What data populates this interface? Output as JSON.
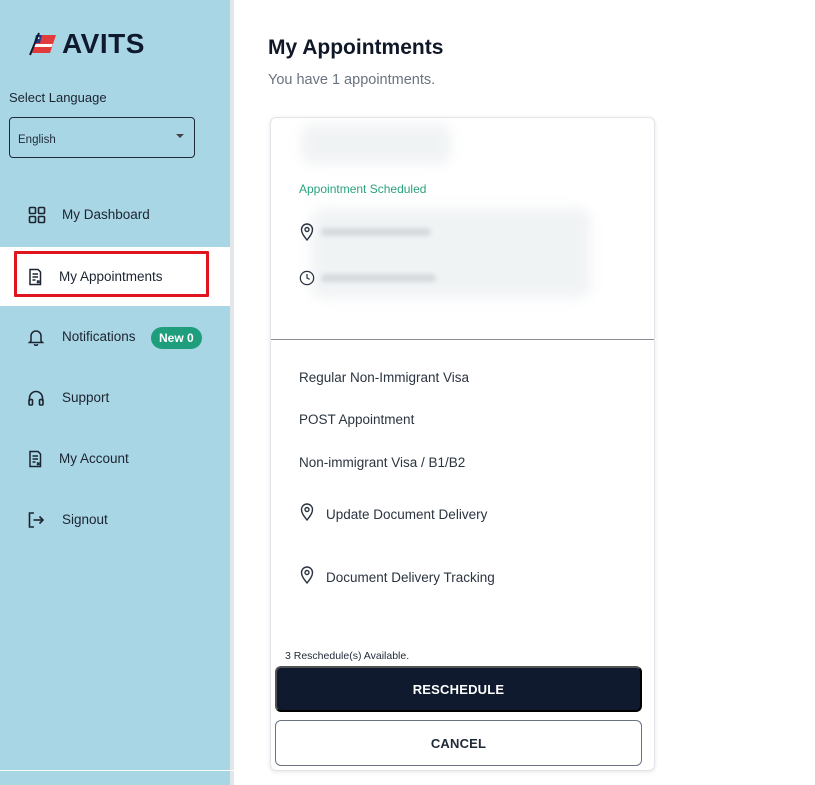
{
  "brand": {
    "name": "AVITS"
  },
  "language": {
    "label": "Select Language",
    "selected": "English"
  },
  "nav": {
    "items": [
      {
        "label": "My Dashboard",
        "icon": "dashboard-grid-icon"
      },
      {
        "label": "My Appointments",
        "icon": "document-icon",
        "active": true
      },
      {
        "label": "Notifications",
        "icon": "bell-icon",
        "badge": "New 0"
      },
      {
        "label": "Support",
        "icon": "headphones-icon"
      },
      {
        "label": "My Account",
        "icon": "document-icon"
      },
      {
        "label": "Signout",
        "icon": "signout-icon"
      }
    ]
  },
  "main": {
    "title": "My Appointments",
    "subtitle": "You have 1 appointments."
  },
  "card": {
    "status": "Appointment Scheduled",
    "visa_category": "Regular Non-Immigrant Visa",
    "appointment_type": "POST Appointment",
    "visa_type": "Non-immigrant Visa / B1/B2",
    "link_delivery": "Update Document Delivery",
    "link_tracking": "Document Delivery Tracking",
    "reschedules_note": "3 Reschedule(s) Available.",
    "reschedule_button": "RESCHEDULE",
    "cancel_button": "CANCEL"
  },
  "colors": {
    "sidebar_bg": "#a9d6e5",
    "accent_dark": "#0f1a2e",
    "status_green": "#2aa37e",
    "badge_green": "#1e9e7c",
    "highlight_red": "#e0141e"
  }
}
